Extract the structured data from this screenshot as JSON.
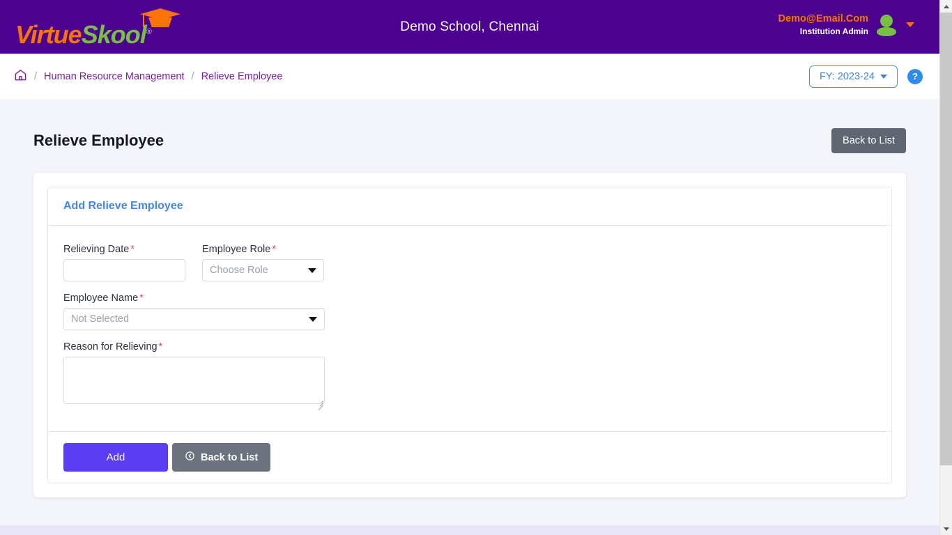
{
  "header": {
    "logo_virtue": "Virtue",
    "logo_skool": "Skool",
    "logo_reg": "®",
    "school_title": "Demo School, Chennai",
    "user_email": "Demo@Email.Com",
    "user_role": "Institution Admin",
    "avatar_icon": "user-avatar-icon",
    "caret_icon": "chevron-down-icon"
  },
  "breadcrumb": {
    "home_icon": "home-icon",
    "sep": "/",
    "items": [
      {
        "label": "Human Resource Management"
      },
      {
        "label": "Relieve Employee"
      }
    ],
    "fy_label": "FY: 2023-24",
    "help_label": "?"
  },
  "page": {
    "title": "Relieve Employee",
    "back_to_list": "Back to List"
  },
  "card": {
    "title": "Add Relieve Employee",
    "fields": {
      "relieving_date": {
        "label": "Relieving Date",
        "required": "*",
        "value": "",
        "placeholder": ""
      },
      "employee_role": {
        "label": "Employee Role",
        "required": "*",
        "value": "Choose Role"
      },
      "employee_name": {
        "label": "Employee Name",
        "required": "*",
        "value": "Not Selected"
      },
      "reason_for_relieving": {
        "label": "Reason for Relieving",
        "required": "*",
        "value": "",
        "placeholder": ""
      }
    },
    "actions": {
      "add": "Add",
      "back_to_list": "Back to List",
      "back_icon": "circle-arrow-left-icon"
    }
  },
  "colors": {
    "brand_purple": "#4d0191",
    "accent_orange": "#f97306",
    "accent_green": "#76c043",
    "link_blue": "#4285f4",
    "primary_button": "#5b3df5",
    "secondary_button": "#6c737f",
    "required_red": "#e8485f",
    "breadcrumb_purple": "#7b1fa2"
  }
}
